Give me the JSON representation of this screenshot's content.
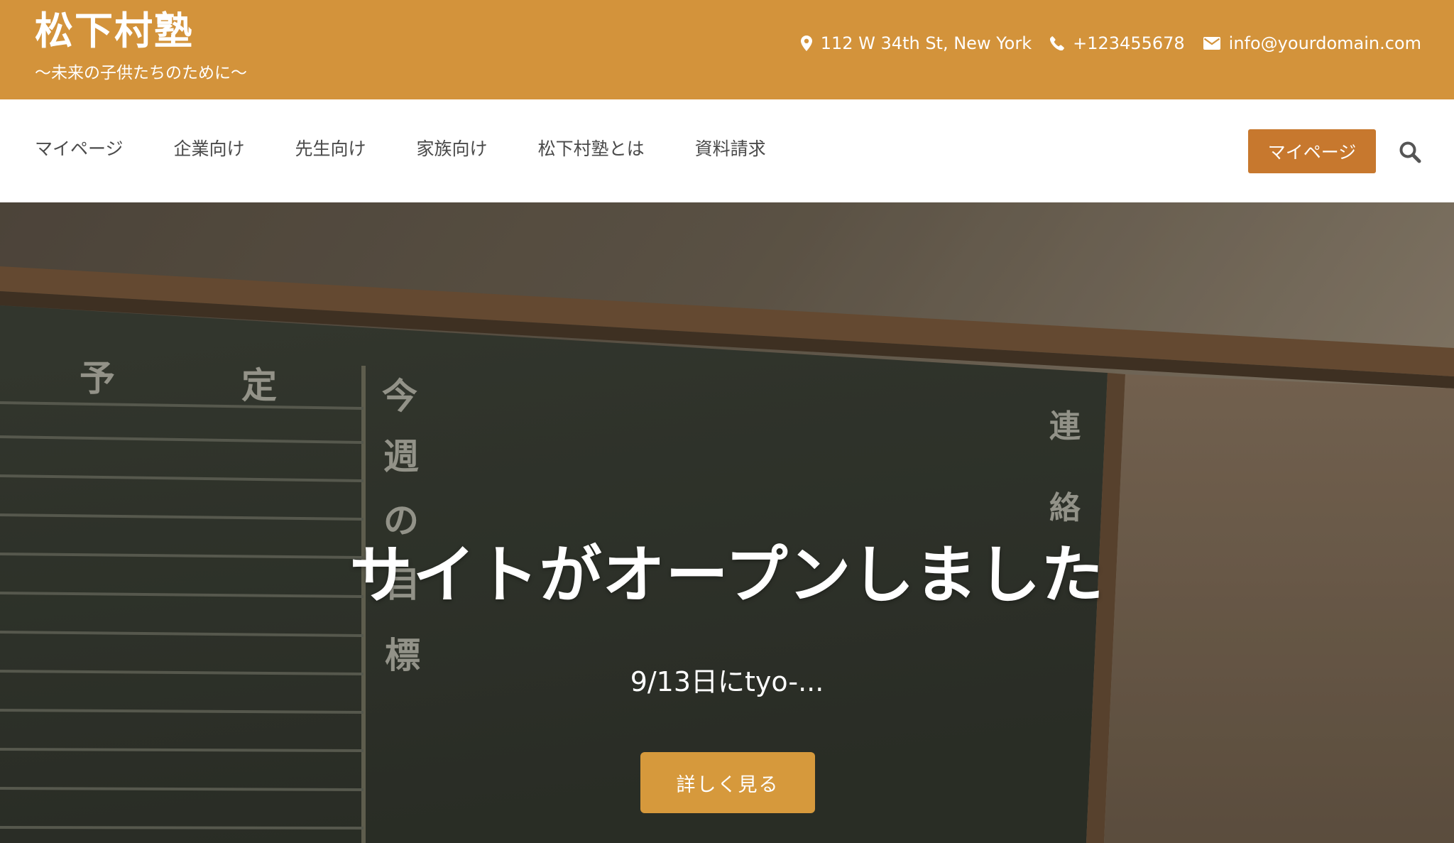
{
  "brand": {
    "title": "松下村塾",
    "tagline": "〜未来の子供たちのために〜",
    "colors": {
      "topbar": "#d3933b",
      "cta": "#c7782e",
      "hero_button": "#d6993c"
    }
  },
  "contact": {
    "address": "112 W 34th St, New York",
    "address_icon": "map-pin-icon",
    "phone": "+123455678",
    "phone_icon": "phone-icon",
    "email": "info@yourdomain.com",
    "email_icon": "envelope-icon"
  },
  "nav": {
    "items": [
      {
        "label": "マイページ"
      },
      {
        "label": "企業向け"
      },
      {
        "label": "先生向け"
      },
      {
        "label": "家族向け"
      },
      {
        "label": "松下村塾とは"
      },
      {
        "label": "資料請求"
      }
    ],
    "cta_label": "マイページ",
    "search_icon": "search-icon"
  },
  "hero": {
    "title": "サイトがオープンしました",
    "subtitle": "9/13日にtyo-...",
    "button_label": "詳しく見る",
    "chalkboard_text": {
      "schedule_1": "予",
      "schedule_2": "定",
      "weekly": [
        "今",
        "週",
        "の",
        "目",
        "標"
      ],
      "contact": [
        "連",
        "絡"
      ]
    }
  }
}
